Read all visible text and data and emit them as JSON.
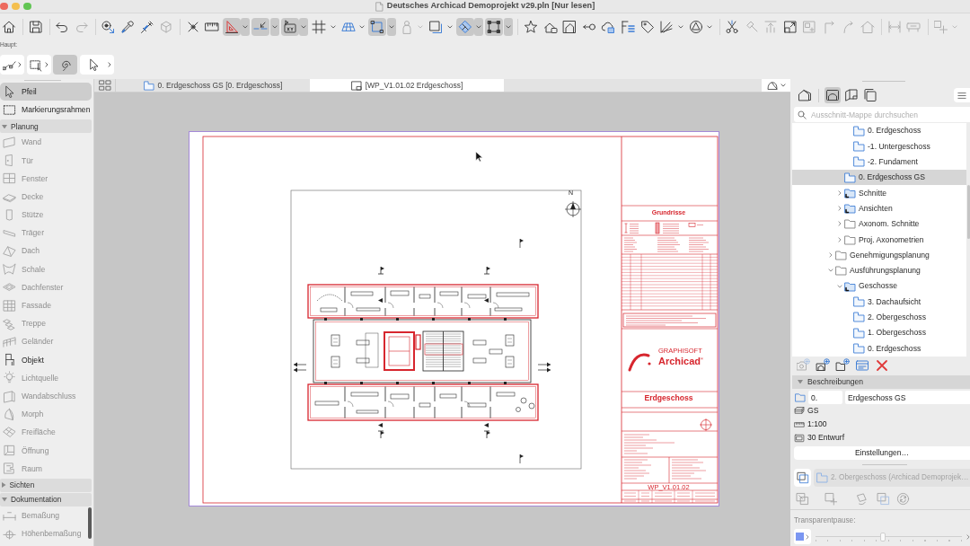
{
  "window": {
    "title": "Deutsches Archicad Demoprojekt v29.pln [Nur lesen]"
  },
  "toolbar": [
    [
      {
        "kind": "button",
        "on": false,
        "disabled": false
      }
    ],
    [
      {
        "kind": "button",
        "on": false,
        "disabled": false
      }
    ],
    [
      {
        "kind": "button",
        "on": false,
        "disabled": false
      },
      {
        "kind": "button",
        "on": false,
        "disabled": true
      }
    ],
    [
      {
        "kind": "button",
        "on": false,
        "disabled": false
      },
      {
        "kind": "button",
        "on": false,
        "disabled": false
      },
      {
        "kind": "button",
        "on": false,
        "disabled": false
      },
      {
        "kind": "button",
        "on": false,
        "disabled": true
      }
    ],
    [
      {
        "kind": "button",
        "on": false,
        "disabled": false
      },
      {
        "kind": "button",
        "on": false,
        "disabled": false
      },
      {
        "kind": "split",
        "on": true,
        "disabled": false
      },
      {
        "kind": "split",
        "on": true,
        "disabled": false
      },
      {
        "kind": "split",
        "on": true,
        "disabled": false
      },
      {
        "kind": "split",
        "on": false,
        "disabled": false
      },
      {
        "kind": "split",
        "on": false,
        "disabled": false
      },
      {
        "kind": "split",
        "on": true,
        "disabled": false
      },
      {
        "kind": "split",
        "on": false,
        "disabled": true
      },
      {
        "kind": "split",
        "on": false,
        "disabled": false
      },
      {
        "kind": "split",
        "on": true,
        "disabled": false
      },
      {
        "kind": "split",
        "on": true,
        "disabled": false
      }
    ],
    [
      {
        "kind": "button",
        "on": false,
        "disabled": false
      },
      {
        "kind": "button",
        "on": false,
        "disabled": false
      },
      {
        "kind": "button",
        "on": false,
        "disabled": false
      },
      {
        "kind": "button",
        "on": false,
        "disabled": false
      },
      {
        "kind": "button",
        "on": false,
        "disabled": false
      },
      {
        "kind": "button",
        "on": false,
        "disabled": false
      },
      {
        "kind": "button",
        "on": false,
        "disabled": false
      },
      {
        "kind": "split",
        "on": false,
        "disabled": false
      },
      {
        "kind": "split",
        "on": false,
        "disabled": false
      }
    ],
    [
      {
        "kind": "button",
        "on": false,
        "disabled": false
      },
      {
        "kind": "button",
        "on": false,
        "disabled": true
      },
      {
        "kind": "button",
        "on": false,
        "disabled": true
      },
      {
        "kind": "button",
        "on": false,
        "disabled": false
      },
      {
        "kind": "button",
        "on": false,
        "disabled": true
      },
      {
        "kind": "button",
        "on": false,
        "disabled": true
      },
      {
        "kind": "button",
        "on": false,
        "disabled": true
      },
      {
        "kind": "button",
        "on": false,
        "disabled": true
      }
    ],
    [
      {
        "kind": "button",
        "on": false,
        "disabled": true
      },
      {
        "kind": "button",
        "on": false,
        "disabled": true
      }
    ],
    [
      {
        "kind": "split",
        "on": false,
        "disabled": true
      }
    ]
  ],
  "info_box": {
    "label": "Haupt:",
    "tools": [
      {
        "kind": "split",
        "on": false
      },
      {
        "kind": "split",
        "on": false
      },
      {
        "kind": "button",
        "on": true
      },
      {
        "kind": "split",
        "on": false
      }
    ]
  },
  "toolbox": {
    "tools": [
      {
        "label": "Pfeil",
        "selected": true,
        "disabled": false
      },
      {
        "label": "Markierungsrahmen",
        "selected": false,
        "disabled": false
      }
    ],
    "groups": [
      {
        "title": "Planung",
        "expanded": true,
        "tools": [
          {
            "label": "Wand",
            "selected": false,
            "disabled": true
          },
          {
            "label": "Tür",
            "selected": false,
            "disabled": true
          },
          {
            "label": "Fenster",
            "selected": false,
            "disabled": true
          },
          {
            "label": "Decke",
            "selected": false,
            "disabled": true
          },
          {
            "label": "Stütze",
            "selected": false,
            "disabled": true
          },
          {
            "label": "Träger",
            "selected": false,
            "disabled": true
          },
          {
            "label": "Dach",
            "selected": false,
            "disabled": true
          },
          {
            "label": "Schale",
            "selected": false,
            "disabled": true
          },
          {
            "label": "Dachfenster",
            "selected": false,
            "disabled": true
          },
          {
            "label": "Fassade",
            "selected": false,
            "disabled": true
          },
          {
            "label": "Treppe",
            "selected": false,
            "disabled": true
          },
          {
            "label": "Geländer",
            "selected": false,
            "disabled": true
          },
          {
            "label": "Objekt",
            "selected": false,
            "disabled": false
          },
          {
            "label": "Lichtquelle",
            "selected": false,
            "disabled": true
          },
          {
            "label": "Wandabschluss",
            "selected": false,
            "disabled": true
          },
          {
            "label": "Morph",
            "selected": false,
            "disabled": true
          },
          {
            "label": "Freifläche",
            "selected": false,
            "disabled": true
          },
          {
            "label": "Öffnung",
            "selected": false,
            "disabled": true
          },
          {
            "label": "Raum",
            "selected": false,
            "disabled": true
          }
        ]
      },
      {
        "title": "Sichten",
        "expanded": false
      },
      {
        "title": "Dokumentation",
        "expanded": true,
        "tools": [
          {
            "label": "Bemaßung",
            "selected": false,
            "disabled": true
          },
          {
            "label": "Höhenbemaßung",
            "selected": false,
            "disabled": true
          }
        ]
      }
    ]
  },
  "tabs": [
    {
      "kind": "plan",
      "label": "0. Erdgeschoss GS [0. Erdgeschoss]",
      "selected": false
    },
    {
      "kind": "layout",
      "label": "[WP_V1.01.02 Erdgeschoss]",
      "selected": true
    }
  ],
  "sheet": {
    "north_label": "N",
    "title_block": {
      "heading": "Grundrisse",
      "brand": "GRAPHISOFT",
      "wordmark": "Archicad$^{®}$",
      "drawing_title": "Erdgeschoss",
      "number": "WP_V1.01.02"
    }
  },
  "navigator": {
    "modes": [
      {
        "selected": false
      },
      {
        "selected": true
      },
      {
        "selected": false
      },
      {
        "selected": false
      }
    ],
    "search": {
      "placeholder": "Ausschnitt-Mappe durchsuchen"
    },
    "tree": [
      {
        "children": [
          {
            "children": [
              {
                "label": "0. Erdgeschoss",
                "kind": "view",
                "selected": false
              },
              {
                "label": "-1. Untergeschoss",
                "kind": "view",
                "selected": false
              },
              {
                "label": "-2. Fundament",
                "kind": "view",
                "selected": false
              }
            ]
          },
          {
            "label": "0. Erdgeschoss GS",
            "kind": "view",
            "selected": true
          },
          {
            "label": "Schnitte",
            "kind": "view-folder",
            "selected": false,
            "expanded": false
          },
          {
            "label": "Ansichten",
            "kind": "view-folder",
            "selected": false,
            "expanded": false
          },
          {
            "label": "Axonom. Schnitte",
            "kind": "folder",
            "selected": false,
            "expanded": false
          },
          {
            "label": "Proj. Axonometrien",
            "kind": "folder",
            "selected": false,
            "expanded": false
          }
        ]
      },
      {
        "label": "Genehmigungsplanung",
        "kind": "folder",
        "selected": false,
        "expanded": false
      },
      {
        "label": "Ausführungsplanung",
        "kind": "folder",
        "selected": false,
        "expanded": true,
        "children": [
          {
            "label": "Geschosse",
            "kind": "view-folder",
            "selected": false,
            "expanded": true,
            "children": [
              {
                "label": "3. Dachaufsicht",
                "kind": "view",
                "selected": false
              },
              {
                "label": "2. Obergeschoss",
                "kind": "view",
                "selected": false
              },
              {
                "label": "1. Obergeschoss",
                "kind": "view",
                "selected": false
              },
              {
                "label": "0. Erdgeschoss",
                "kind": "view",
                "selected": false
              }
            ]
          }
        ]
      }
    ],
    "actions": [
      {
        "disabled": true
      },
      {
        "disabled": false
      },
      {
        "disabled": false
      },
      {
        "disabled": false
      },
      {
        "disabled": false
      }
    ]
  },
  "properties": {
    "title": "Beschreibungen",
    "expanded": true,
    "fields": [
      {
        "value": "0."
      },
      {
        "value": "Erdgeschoss GS"
      }
    ],
    "rows": [
      {
        "kind": "layers",
        "text": "GS"
      },
      {
        "kind": "scale",
        "text": "1:100"
      },
      {
        "kind": "display",
        "text": "30 Entwurf"
      }
    ],
    "button": "Einstellungen…"
  },
  "trace": {
    "reference": {
      "text": "2. Obergeschoss (Archicad Demoprojek…",
      "disabled": true
    },
    "tools": [
      {
        "disabled": true
      },
      {
        "disabled": true
      },
      {
        "disabled": true
      },
      {
        "disabled": true
      },
      {
        "disabled": true
      }
    ],
    "label": "Transparentpause:",
    "level": 0.46
  }
}
